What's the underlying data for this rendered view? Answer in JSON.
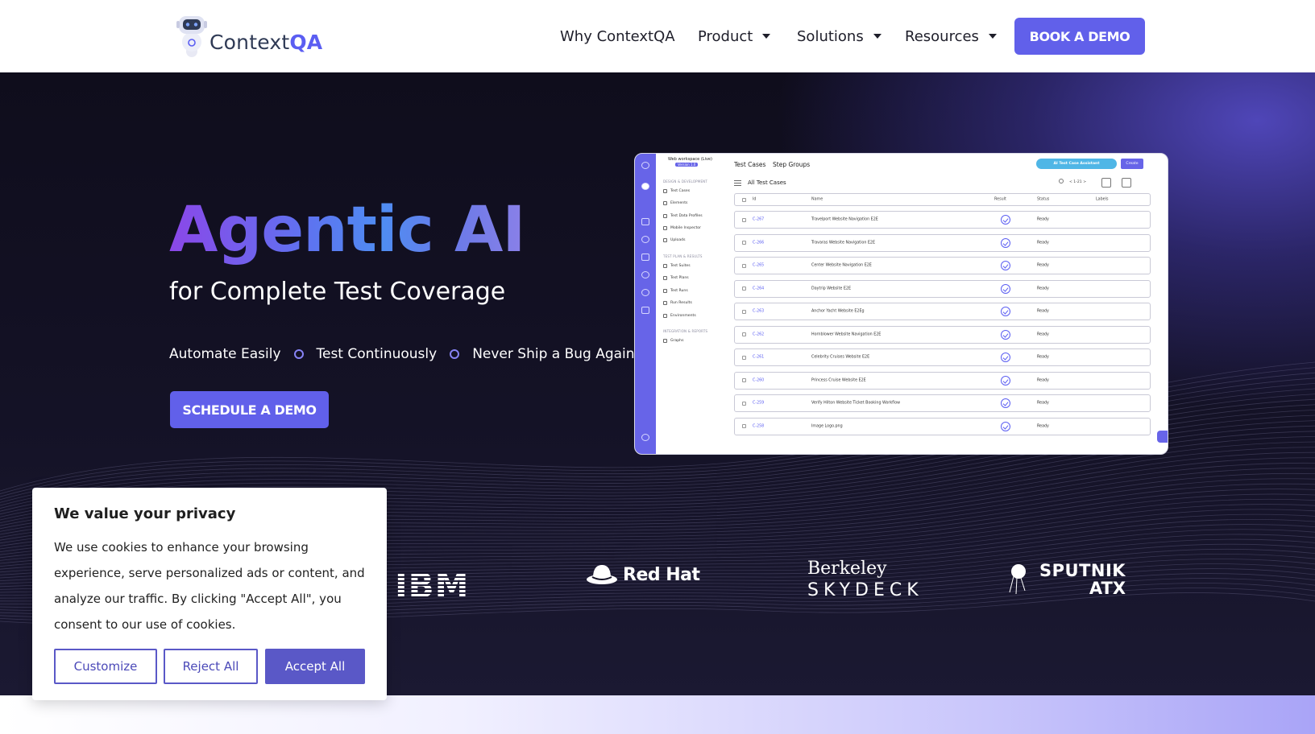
{
  "header": {
    "logo_text_main": "Context",
    "logo_text_accent": "QA",
    "nav": [
      {
        "label": "Why ContextQA",
        "dropdown": false
      },
      {
        "label": "Product",
        "dropdown": true
      },
      {
        "label": "Solutions",
        "dropdown": true
      },
      {
        "label": "Resources",
        "dropdown": true
      }
    ],
    "cta": "BOOK A DEMO"
  },
  "hero": {
    "title": "Agentic AI",
    "subtitle": "for Complete Test Coverage",
    "bullets": [
      "Automate Easily",
      "Test Continuously",
      "Never Ship a Bug Again"
    ],
    "cta": "SCHEDULE A DEMO"
  },
  "app_preview": {
    "workspace": "Web workspace (Live)",
    "version": "Version 1.0",
    "tabs": [
      "Test Cases",
      "Step Groups"
    ],
    "ai_button": "AI Test Case Assistant",
    "create_button": "Create",
    "list_title": "All Test Cases",
    "pager": "< 1-21 >",
    "sidebar_sections": [
      {
        "title": "DESIGN & DEVELOPMENT",
        "items": [
          "Test Cases",
          "Elements",
          "Test Data Profiles",
          "Mobile Inspector",
          "Uploads"
        ]
      },
      {
        "title": "TEST PLAN & RESULTS",
        "items": [
          "Test Suites",
          "Test Plans",
          "Test Runs",
          "Run Results",
          "Environments"
        ]
      },
      {
        "title": "INTEGRATION & REPORTS",
        "items": [
          "Graphs"
        ]
      }
    ],
    "columns": [
      "Id",
      "Name",
      "Result",
      "Status",
      "Labels"
    ],
    "rows": [
      {
        "id": "C-267",
        "name": "Travelport Website Navigation E2E",
        "status": "Ready"
      },
      {
        "id": "C-266",
        "name": "Travaras Website Navigation E2E",
        "status": "Ready"
      },
      {
        "id": "C-265",
        "name": "Center Website Navigation E2E",
        "status": "Ready"
      },
      {
        "id": "C-264",
        "name": "Daytrip Website E2E",
        "status": "Ready"
      },
      {
        "id": "C-263",
        "name": "Anchor Yacht Website E2Eg",
        "status": "Ready"
      },
      {
        "id": "C-262",
        "name": "Hornblower Website Navigation E2E",
        "status": "Ready"
      },
      {
        "id": "C-261",
        "name": "Celebrity Cruises Website E2E",
        "status": "Ready"
      },
      {
        "id": "C-260",
        "name": "Princess Cruise Website E2E",
        "status": "Ready"
      },
      {
        "id": "C-259",
        "name": "Verify Hilton Website Ticket Booking Workflow",
        "status": "Ready"
      },
      {
        "id": "C-258",
        "name": "Image Logo.png",
        "status": "Ready"
      }
    ]
  },
  "brands": {
    "ibm": "IBM",
    "redhat": "Red Hat",
    "berkeley_line1": "Berkeley",
    "berkeley_line2": "SKYDECK",
    "sputnik_line1": "SPUTNIK",
    "sputnik_line2": "ATX"
  },
  "cookie": {
    "title": "We value your privacy",
    "body": "We use cookies to enhance your browsing experience, serve personalized ads or content, and analyze our traffic. By clicking \"Accept All\", you consent to our use of cookies.",
    "customize": "Customize",
    "reject": "Reject All",
    "accept": "Accept All"
  },
  "colors": {
    "accent": "#6160ea",
    "hero_bg": "#141226"
  }
}
